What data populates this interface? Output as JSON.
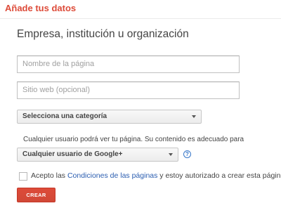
{
  "header": {
    "title": "Añade tus datos"
  },
  "section": {
    "title": "Empresa, institución u organización"
  },
  "fields": {
    "page_name_placeholder": "Nombre de la página",
    "website_placeholder": "Sitio web (opcional)"
  },
  "category_select": {
    "value": "Selecciona una categoría",
    "icon": "chevron-down-icon"
  },
  "audience": {
    "description": "Cualquier usuario podrá ver tu página. Su contenido es adecuado para",
    "value": "Cualquier usuario de Google+",
    "help_icon": "?"
  },
  "consent": {
    "prefix": "Acepto las ",
    "link": "Condiciones de las páginas",
    "suffix": " y estoy autorizado a crear esta página.",
    "checked": false
  },
  "submit": {
    "label": "CREAR"
  },
  "colors": {
    "accent": "#dd4b39",
    "link": "#2a5db0"
  }
}
